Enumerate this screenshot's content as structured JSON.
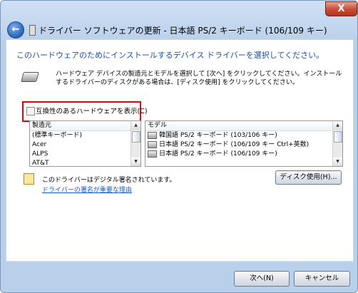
{
  "window": {
    "title": "ドライバー ソフトウェアの更新 - 日本語 PS/2 キーボード (106/109 キー)",
    "close_label": "X",
    "back_label": "←"
  },
  "main": {
    "heading": "このハードウェアのためにインストールするデバイス ドライバーを選択してください。",
    "instructions": "ハードウェア デバイスの製造元とモデルを選択して [次へ] をクリックしてください。インストールするドライバーのディスクがある場合は、[ディスク使用] をクリックしてください。",
    "compat_checkbox_label": "互換性のあるハードウェアを表示(C)",
    "compat_checked": false,
    "manufacturer_header": "製造元",
    "manufacturers": [
      "(標準キーボード)",
      "Acer",
      "ALPS",
      "AT&T"
    ],
    "model_header": "モデル",
    "models": [
      "韓国語 PS/2 キーボード (103/106 キー)",
      "日本語 PS/2 キーボード (106/109 キー Ctrl+英数)",
      "日本語 PS/2 キーボード (106/109 キー)"
    ],
    "signed_text": "このドライバーはデジタル署名されています。",
    "signed_link": "ドライバーの署名が重要な理由",
    "disk_button": "ディスク使用(H)..."
  },
  "footer": {
    "next_button": "次へ(N)",
    "cancel_button": "キャンセル"
  },
  "colors": {
    "accent": "#1e4fa6",
    "highlight_box": "#e60012",
    "link": "#1b59c6"
  }
}
